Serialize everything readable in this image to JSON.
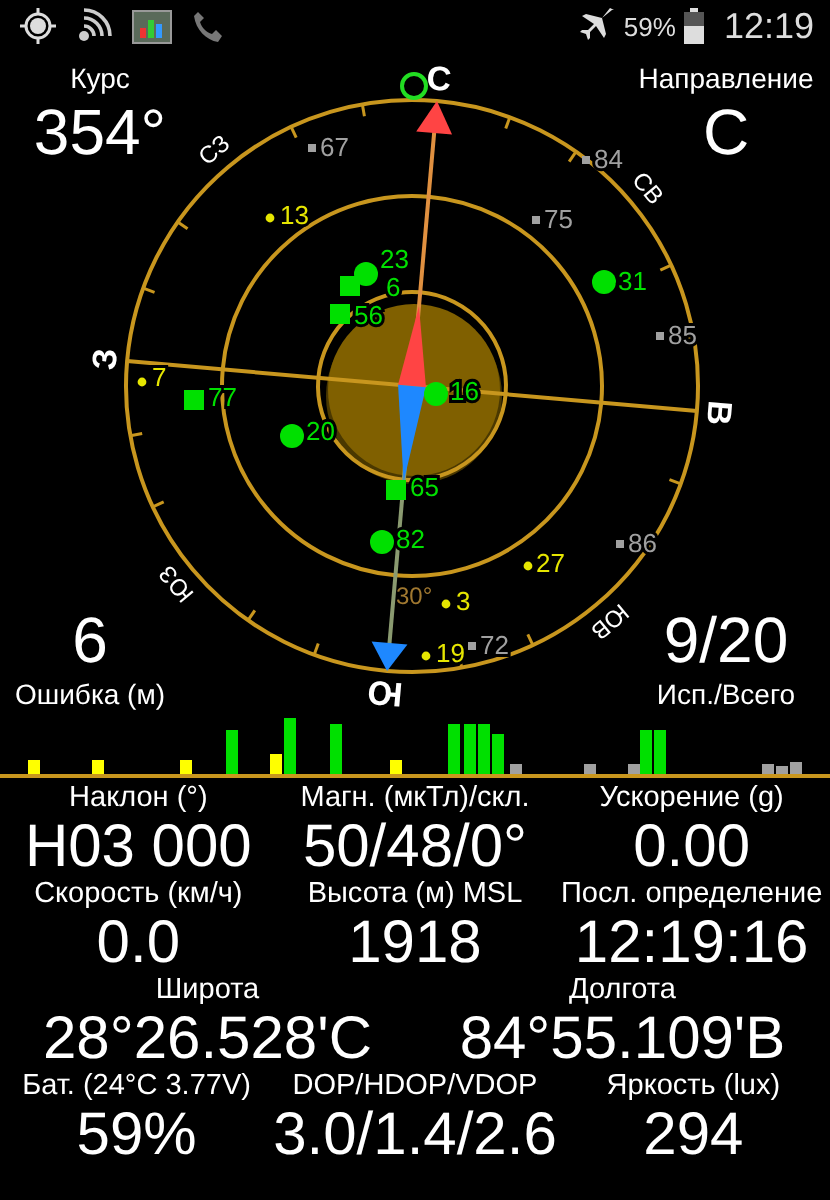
{
  "status_bar": {
    "battery_text": "59%",
    "time": "12:19"
  },
  "heading": {
    "label": "Курс",
    "value": "354°"
  },
  "direction": {
    "label": "Направление",
    "value": "С"
  },
  "error": {
    "value": "6",
    "label": "Ошибка (м)"
  },
  "satellite_count": {
    "value": "9/20",
    "label": "Исп./Всего"
  },
  "compass": {
    "cardinals": [
      "С",
      "СВ",
      "В",
      "ЮВ",
      "Ю",
      "ЮЗ",
      "З",
      "СЗ"
    ],
    "angle_label": "30°"
  },
  "satellites": [
    {
      "label": "67",
      "kind": "small-square",
      "color": "#a0a0a0"
    },
    {
      "label": "84",
      "kind": "small-square",
      "color": "#a0a0a0"
    },
    {
      "label": "13",
      "kind": "dot",
      "color": "#e6e600"
    },
    {
      "label": "75",
      "kind": "small-square",
      "color": "#a0a0a0"
    },
    {
      "label": "23",
      "kind": "circle",
      "color": "#00e000"
    },
    {
      "label": "6",
      "kind": "square",
      "color": "#00e000"
    },
    {
      "label": "56",
      "kind": "square",
      "color": "#00e000"
    },
    {
      "label": "31",
      "kind": "circle",
      "color": "#00e000"
    },
    {
      "label": "85",
      "kind": "small-square",
      "color": "#a0a0a0"
    },
    {
      "label": "7",
      "kind": "dot",
      "color": "#e6e600"
    },
    {
      "label": "77",
      "kind": "square",
      "color": "#00e000"
    },
    {
      "label": "16",
      "kind": "circle",
      "color": "#00e000"
    },
    {
      "label": "20",
      "kind": "circle",
      "color": "#00e000"
    },
    {
      "label": "65",
      "kind": "square",
      "color": "#00e000"
    },
    {
      "label": "82",
      "kind": "circle",
      "color": "#00e000"
    },
    {
      "label": "86",
      "kind": "small-square",
      "color": "#a0a0a0"
    },
    {
      "label": "27",
      "kind": "dot",
      "color": "#e6e600"
    },
    {
      "label": "3",
      "kind": "dot",
      "color": "#e6e600"
    },
    {
      "label": "19",
      "kind": "dot",
      "color": "#e6e600"
    },
    {
      "label": "72",
      "kind": "small-square",
      "color": "#a0a0a0"
    }
  ],
  "signal_bars": [
    {
      "color": "#ffff00"
    },
    {
      "color": "#ffff00"
    },
    {
      "color": "#ffff00"
    },
    {
      "color": "#00e000"
    },
    {
      "color": "#ffff00"
    },
    {
      "color": "#00e000"
    },
    {
      "color": "#00e000"
    },
    {
      "color": "#ffff00"
    },
    {
      "color": "#00e000"
    },
    {
      "color": "#00e000"
    },
    {
      "color": "#00e000"
    },
    {
      "color": "#00e000"
    },
    {
      "color": "#a0a0a0"
    },
    {
      "color": "#a0a0a0"
    },
    {
      "color": "#a0a0a0"
    },
    {
      "color": "#00e000"
    },
    {
      "color": "#00e000"
    },
    {
      "color": "#a0a0a0"
    },
    {
      "color": "#a0a0a0"
    },
    {
      "color": "#a0a0a0"
    }
  ],
  "readings": [
    [
      {
        "label": "Наклон (°)",
        "value": "Н03 000"
      },
      {
        "label": "Магн. (мкТл)/скл.",
        "value": "50/48/0°"
      },
      {
        "label": "Ускорение (g)",
        "value": "0.00"
      }
    ],
    [
      {
        "label": "Скорость (км/ч)",
        "value": "0.0"
      },
      {
        "label": "Высота (м) MSL",
        "value": "1918"
      },
      {
        "label": "Посл. определение",
        "value": "12:19:16"
      }
    ],
    [
      {
        "label": "Широта",
        "value": "28°26.528'С"
      },
      {
        "label": "Долгота",
        "value": "84°55.109'В"
      }
    ],
    [
      {
        "label": "Бат. (24°C 3.77V)",
        "value": "59%"
      },
      {
        "label": "DOP/HDOP/VDOP",
        "value": "3.0/1.4/2.6"
      },
      {
        "label": "Яркость (lux)",
        "value": "294"
      }
    ]
  ]
}
